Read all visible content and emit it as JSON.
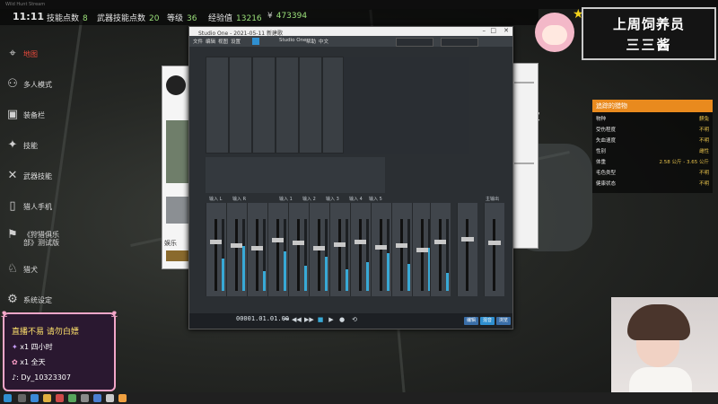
{
  "window_caption": "Wild Hunt Stream",
  "hud": {
    "time": "11:11",
    "stats": [
      {
        "label": "技能点数",
        "value": "8"
      },
      {
        "label": "武器技能点数",
        "value": "20"
      },
      {
        "label": "等级",
        "value": "36"
      },
      {
        "label": "经验值",
        "value": "13216"
      },
      {
        "label": "",
        "value": "473394"
      }
    ]
  },
  "menu": [
    {
      "label": "地图",
      "icon": "map-icon",
      "active": true
    },
    {
      "label": "多人模式",
      "icon": "multiplayer-icon",
      "active": false
    },
    {
      "label": "装备栏",
      "icon": "backpack-icon",
      "active": false
    },
    {
      "label": "技能",
      "icon": "skills-icon",
      "active": false
    },
    {
      "label": "武器技能",
      "icon": "weapon-skills-icon",
      "active": false
    },
    {
      "label": "猎人手机",
      "icon": "phone-icon",
      "active": false
    },
    {
      "label": "《狩猎俱乐部》测试版",
      "icon": "club-icon",
      "active": false
    },
    {
      "label": "猎犬",
      "icon": "dog-icon",
      "active": false
    },
    {
      "label": "系统设定",
      "icon": "settings-icon",
      "active": false
    }
  ],
  "streamer_title": {
    "line1": "上周饲养员",
    "line2": "三三酱"
  },
  "info_panel": {
    "header": "追踪的猎物",
    "rows": [
      {
        "key": "物种",
        "value": "麒兔"
      },
      {
        "key": "受伤程度",
        "value": "不明"
      },
      {
        "key": "失血速度",
        "value": "不明"
      },
      {
        "key": "性别",
        "value": "雌性"
      },
      {
        "key": "体重",
        "value": "2.58 公斤 - 3.65 公斤"
      },
      {
        "key": "毛色类型",
        "value": "不明"
      },
      {
        "key": "健康状态",
        "value": "不明"
      }
    ]
  },
  "map_labels": {
    "big": "场快",
    "sub": "川"
  },
  "daw": {
    "title": "Studio One - 2021-05-11 新建歌",
    "menus": [
      "文件",
      "编辑",
      "视图",
      "设置",
      "Studio One",
      "帮助",
      "中文"
    ],
    "time": "00001.01.01.00",
    "tabs": [
      "编辑",
      "混音",
      "浏览"
    ],
    "tab_colors": [
      "#3a6ea8",
      "#2f8fd0",
      "#3a6ea8"
    ],
    "channel_labels": [
      "输入 L",
      "输入 R",
      "输入 1",
      "输入 2",
      "输入 3",
      "输入 4",
      "输入 5",
      "主输出"
    ],
    "meters": [
      0.45,
      0.62,
      0.28,
      0.55,
      0.35,
      0.48,
      0.3,
      0.4,
      0.52,
      0.38,
      0.6,
      0.25
    ],
    "faders": [
      0.7,
      0.65,
      0.6,
      0.72,
      0.68,
      0.6,
      0.66,
      0.7,
      0.62,
      0.64,
      0.58,
      0.7,
      0.74,
      0.69
    ]
  },
  "stream_box": {
    "line1": "直播不易 请勿白嫖",
    "line2": "x1 四小时",
    "line3": "x1 全天",
    "line4": ": Dy_10323307"
  },
  "browser_side": {
    "text": "娱乐"
  }
}
